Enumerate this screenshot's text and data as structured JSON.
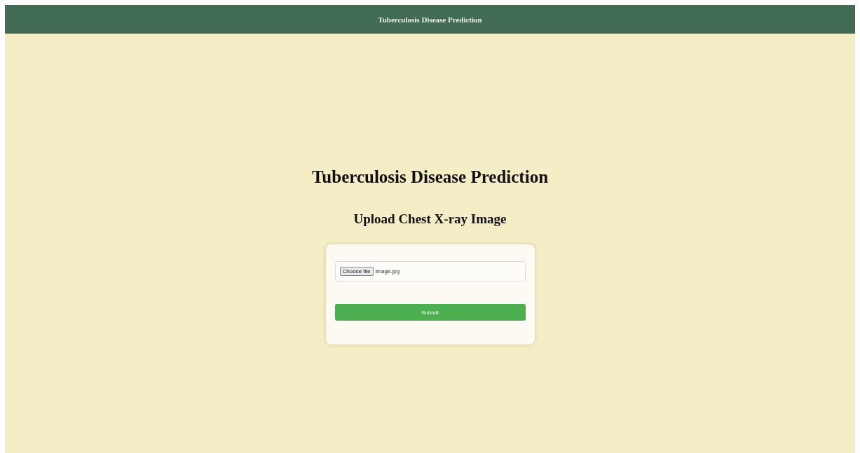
{
  "header": {
    "title": "Tuberculosis Disease Prediction"
  },
  "heading": "Tuberculosis Disease Prediction",
  "subheading": "Upload Chest X-ray Image",
  "upload": {
    "button": "Choose file",
    "file_name": "image.jpg"
  },
  "submit": "Submit"
}
